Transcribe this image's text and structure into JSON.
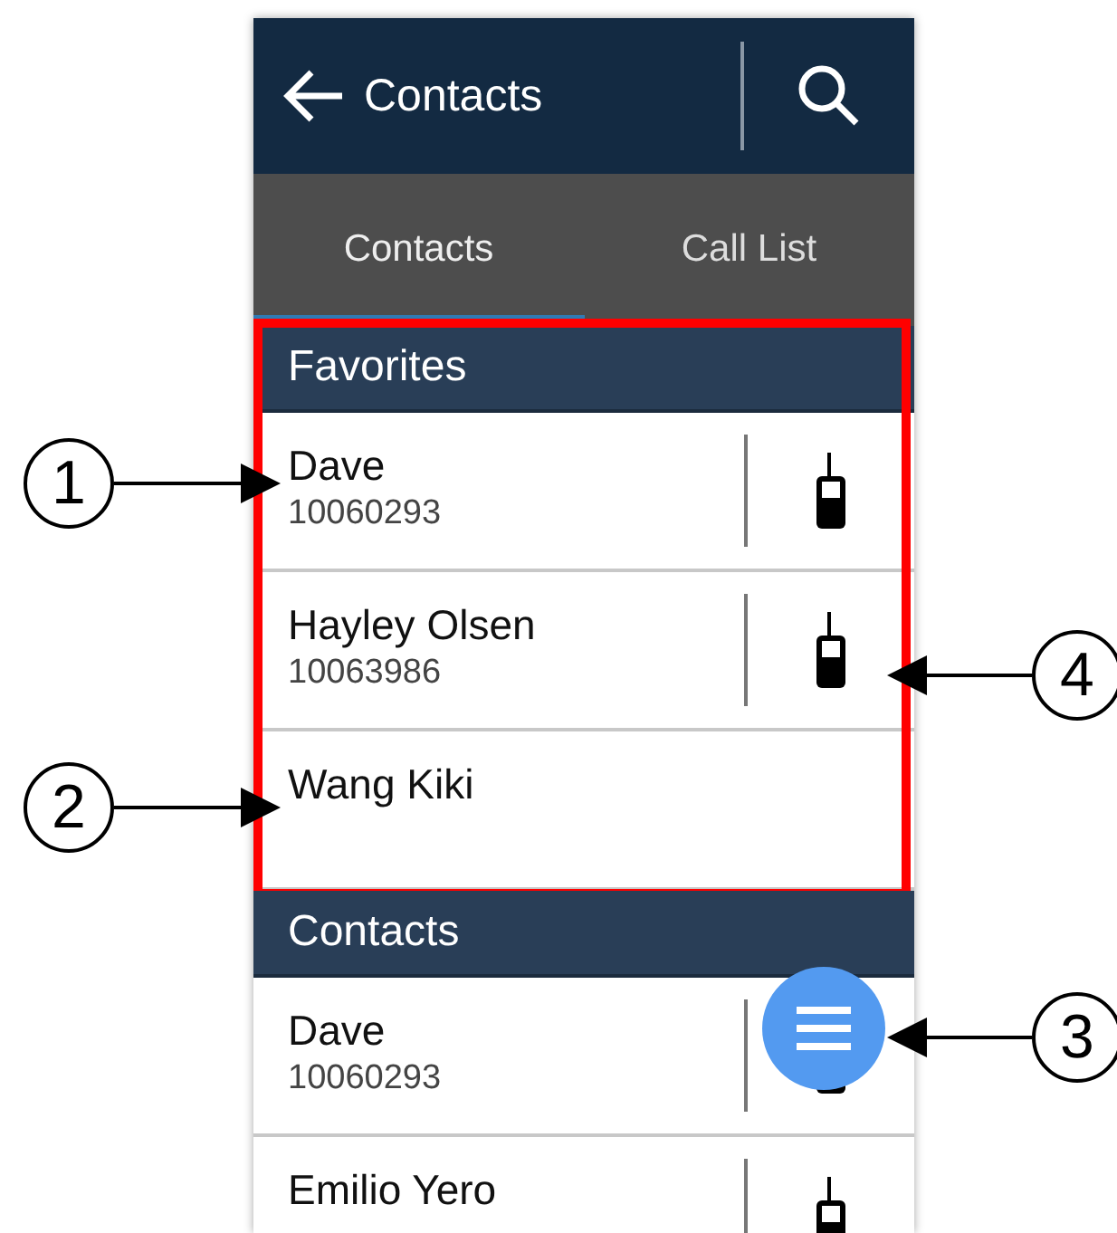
{
  "header": {
    "title": "Contacts"
  },
  "tabs": [
    {
      "label": "Contacts",
      "selected": true
    },
    {
      "label": "Call List",
      "selected": false
    }
  ],
  "sections": [
    {
      "title": "Favorites",
      "highlighted": true,
      "contacts": [
        {
          "name": "Dave",
          "number": "10060293",
          "radio": true
        },
        {
          "name": "Hayley Olsen",
          "number": "10063986",
          "radio": true
        },
        {
          "name": "Wang Kiki",
          "radio": false
        }
      ]
    },
    {
      "title": "Contacts",
      "highlighted": false,
      "contacts": [
        {
          "name": "Dave",
          "number": "10060293",
          "radio": true
        },
        {
          "name": "Emilio Yero",
          "radio": true
        }
      ]
    }
  ],
  "callouts": [
    {
      "label": "1"
    },
    {
      "label": "2"
    },
    {
      "label": "3"
    },
    {
      "label": "4"
    }
  ]
}
